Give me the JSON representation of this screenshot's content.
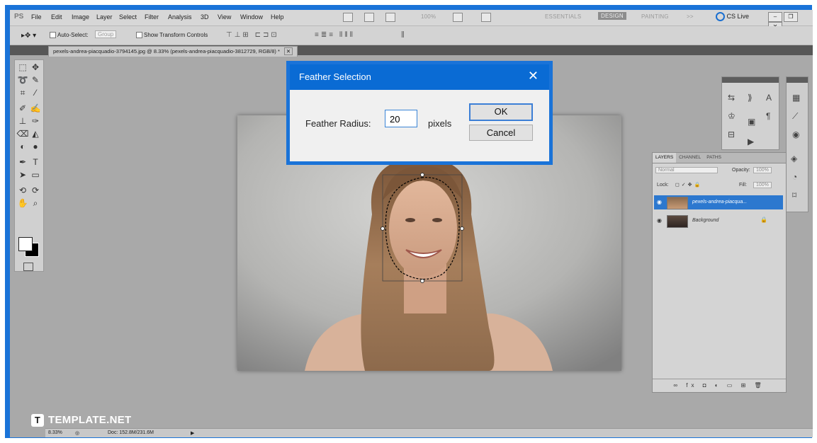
{
  "menubar": {
    "app_logo": "PS",
    "menus": [
      "File",
      "Edit",
      "Image",
      "Layer",
      "Select",
      "Filter",
      "Analysis",
      "3D",
      "View",
      "Window",
      "Help"
    ],
    "zoom": "100%",
    "workspaces": [
      "ESSENTIALS",
      "DESIGN",
      "PAINTING",
      ">>"
    ],
    "cs_live": "CS Live"
  },
  "options": {
    "auto_select_label": "Auto-Select:",
    "auto_select_value": "Group",
    "transform_label": "Show Transform Controls"
  },
  "document": {
    "tab_title": "pexels-andrea-piacquadio-3794145.jpg @ 8.33% (pexels-andrea-piacquadio-3812729, RGB/8) *"
  },
  "dialog": {
    "title": "Feather Selection",
    "radius_label": "Feather Radius:",
    "radius_value": "20",
    "unit": "pixels",
    "ok_label": "OK",
    "cancel_label": "Cancel"
  },
  "layers_panel": {
    "tabs": [
      "LAYERS",
      "CHANNEL",
      "PATHS"
    ],
    "blend_mode": "Normal",
    "opacity_label": "Opacity:",
    "opacity_value": "100%",
    "lock_label": "Lock:",
    "fill_label": "Fill:",
    "fill_value": "100%",
    "layers": [
      {
        "name": "pexels-andrea-piacqua...",
        "selected": true
      },
      {
        "name": "Background",
        "selected": false
      }
    ]
  },
  "watermark": "TEMPLATE.NET",
  "status": {
    "zoom": "8.33%",
    "doc": "Doc: 152.8M/231.6M"
  },
  "colors": {
    "frame_border": "#1a73d8",
    "dialog_title_bg": "#0a6bd4",
    "selected_layer": "#2c78cf"
  }
}
